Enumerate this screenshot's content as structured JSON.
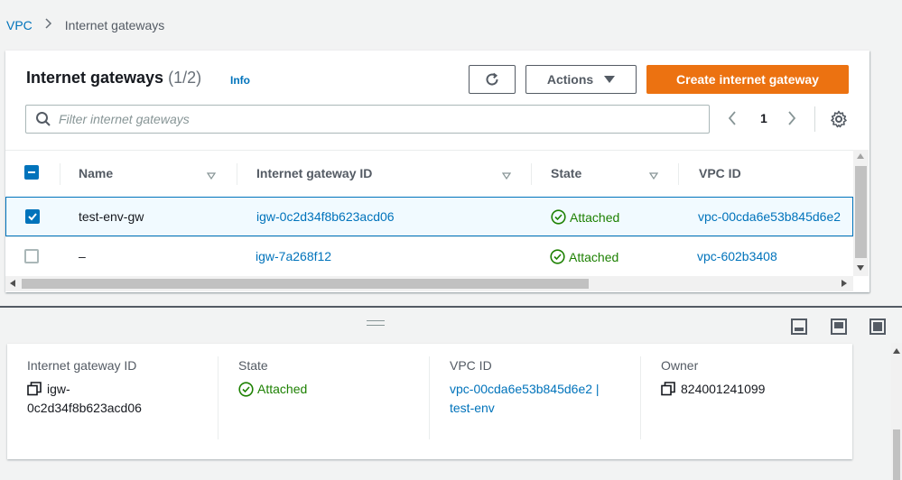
{
  "breadcrumb": {
    "root": "VPC",
    "current": "Internet gateways"
  },
  "panel": {
    "title": "Internet gateways",
    "count": "(1/2)",
    "info": "Info",
    "actions_label": "Actions",
    "create_label": "Create internet gateway",
    "search_placeholder": "Filter internet gateways",
    "page": "1"
  },
  "table": {
    "columns": [
      "Name",
      "Internet gateway ID",
      "State",
      "VPC ID"
    ],
    "rows": [
      {
        "name": "test-env-gw",
        "igw_id": "igw-0c2d34f8b623acd06",
        "state": "Attached",
        "vpc_id": "vpc-00cda6e53b845d6e2",
        "selected": true
      },
      {
        "name": "–",
        "igw_id": "igw-7a268f12",
        "state": "Attached",
        "vpc_id": "vpc-602b3408",
        "selected": false
      }
    ]
  },
  "details": {
    "igw_label": "Internet gateway ID",
    "igw_value_line1": "igw-",
    "igw_value_line2": "0c2d34f8b623acd06",
    "state_label": "State",
    "state_value": "Attached",
    "vpc_label": "VPC ID",
    "vpc_value_line1": "vpc-00cda6e53b845d6e2 |",
    "vpc_value_line2": "test-env",
    "owner_label": "Owner",
    "owner_value": "824001241099"
  },
  "colors": {
    "link": "#0073bb",
    "primary": "#ec7211",
    "success": "#1d8102"
  }
}
